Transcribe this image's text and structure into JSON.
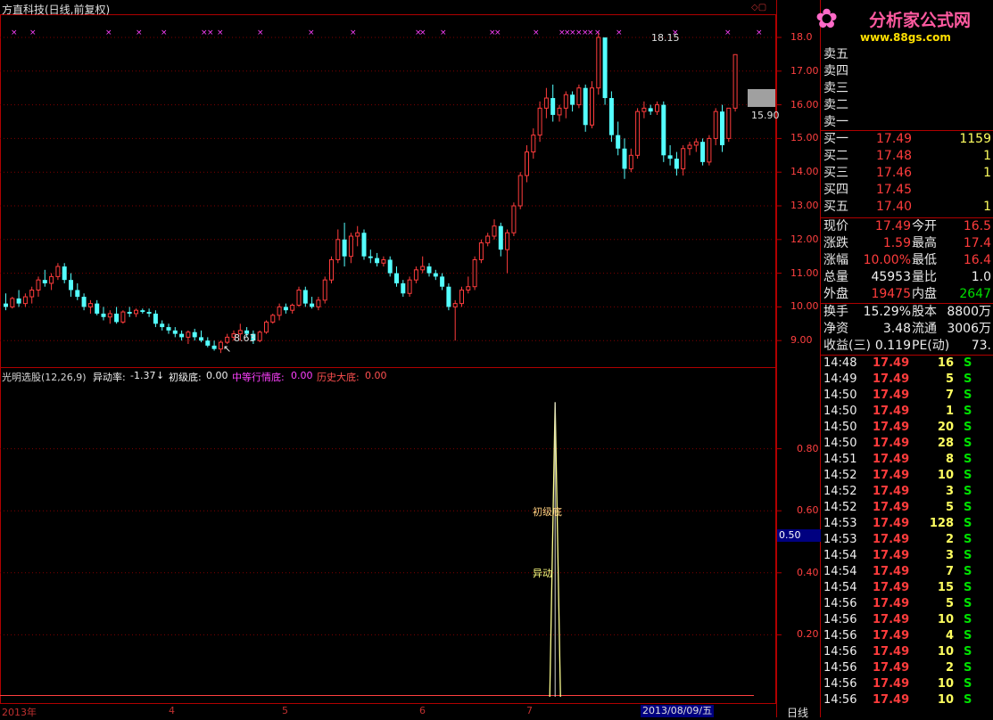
{
  "window": {
    "title": "方直科技(日线,前复权)"
  },
  "logo": {
    "name": "分析家公式网",
    "url": "www.88gs.com"
  },
  "indicator": {
    "name": "光明选股(12,26,9)",
    "yidong_label": "异动率:",
    "yidong_value": "-1.37",
    "chuji_label": "初级底:",
    "chuji_value": "0.00",
    "zhong_label": "中等行情底:",
    "zhong_value": "0.00",
    "lishi_label": "历史大底:",
    "lishi_value": "0.00",
    "signal_label_1": "初级底",
    "signal_label_2": "异动"
  },
  "price_axis": [
    "18.0",
    "17.00",
    "16.00",
    "15.00",
    "14.00",
    "13.00",
    "12.00",
    "11.00",
    "10.00",
    "9.00"
  ],
  "ind_axis": [
    "0.80",
    "0.60",
    "0.40",
    "0.20"
  ],
  "ind_cursor_value": "0.50",
  "x_axis": {
    "labels": [
      "2013年",
      "4",
      "5",
      "6",
      "7"
    ],
    "cursor_date": "2013/08/09/五",
    "period": "日线"
  },
  "annotations": {
    "high": "18.15",
    "low": "8.63",
    "last": "15.90"
  },
  "order_book": {
    "sell": [
      {
        "label": "卖五",
        "price": "",
        "vol": ""
      },
      {
        "label": "卖四",
        "price": "",
        "vol": ""
      },
      {
        "label": "卖三",
        "price": "",
        "vol": ""
      },
      {
        "label": "卖二",
        "price": "",
        "vol": ""
      },
      {
        "label": "卖一",
        "price": "",
        "vol": ""
      }
    ],
    "buy": [
      {
        "label": "买一",
        "price": "17.49",
        "vol": "1159"
      },
      {
        "label": "买二",
        "price": "17.48",
        "vol": "1"
      },
      {
        "label": "买三",
        "price": "17.46",
        "vol": "1"
      },
      {
        "label": "买四",
        "price": "17.45",
        "vol": ""
      },
      {
        "label": "买五",
        "price": "17.40",
        "vol": "1"
      }
    ]
  },
  "quote": [
    {
      "l1": "现价",
      "v1": "17.49",
      "c1": "red",
      "l2": "今开",
      "v2": "16.5",
      "c2": "red"
    },
    {
      "l1": "涨跌",
      "v1": "1.59",
      "c1": "red",
      "l2": "最高",
      "v2": "17.4",
      "c2": "red"
    },
    {
      "l1": "涨幅",
      "v1": "10.00%",
      "c1": "red",
      "l2": "最低",
      "v2": "16.4",
      "c2": "red"
    },
    {
      "l1": "总量",
      "v1": "45953",
      "c1": "wht",
      "l2": "量比",
      "v2": "1.0",
      "c2": "wht"
    },
    {
      "l1": "外盘",
      "v1": "19475",
      "c1": "red",
      "l2": "内盘",
      "v2": "2647",
      "c2": "grn"
    }
  ],
  "fundamentals": [
    {
      "l1": "换手",
      "v1": "15.29%",
      "l2": "股本",
      "v2": "8800万"
    },
    {
      "l1": "净资",
      "v1": "3.48",
      "l2": "流通",
      "v2": "3006万"
    },
    {
      "l1": "收益(三)",
      "v1": "0.119",
      "l2": "PE(动)",
      "v2": "73."
    }
  ],
  "ticks": [
    {
      "t": "14:48",
      "p": "17.49",
      "v": "16",
      "s": "S"
    },
    {
      "t": "14:49",
      "p": "17.49",
      "v": "5",
      "s": "S"
    },
    {
      "t": "14:50",
      "p": "17.49",
      "v": "7",
      "s": "S"
    },
    {
      "t": "14:50",
      "p": "17.49",
      "v": "1",
      "s": "S"
    },
    {
      "t": "14:50",
      "p": "17.49",
      "v": "20",
      "s": "S"
    },
    {
      "t": "14:50",
      "p": "17.49",
      "v": "28",
      "s": "S"
    },
    {
      "t": "14:51",
      "p": "17.49",
      "v": "8",
      "s": "S"
    },
    {
      "t": "14:52",
      "p": "17.49",
      "v": "10",
      "s": "S"
    },
    {
      "t": "14:52",
      "p": "17.49",
      "v": "3",
      "s": "S"
    },
    {
      "t": "14:52",
      "p": "17.49",
      "v": "5",
      "s": "S"
    },
    {
      "t": "14:53",
      "p": "17.49",
      "v": "128",
      "s": "S"
    },
    {
      "t": "14:53",
      "p": "17.49",
      "v": "2",
      "s": "S"
    },
    {
      "t": "14:54",
      "p": "17.49",
      "v": "3",
      "s": "S"
    },
    {
      "t": "14:54",
      "p": "17.49",
      "v": "7",
      "s": "S"
    },
    {
      "t": "14:54",
      "p": "17.49",
      "v": "15",
      "s": "S"
    },
    {
      "t": "14:56",
      "p": "17.49",
      "v": "5",
      "s": "S"
    },
    {
      "t": "14:56",
      "p": "17.49",
      "v": "10",
      "s": "S"
    },
    {
      "t": "14:56",
      "p": "17.49",
      "v": "4",
      "s": "S"
    },
    {
      "t": "14:56",
      "p": "17.49",
      "v": "10",
      "s": "S"
    },
    {
      "t": "14:56",
      "p": "17.49",
      "v": "2",
      "s": "S"
    },
    {
      "t": "14:56",
      "p": "17.49",
      "v": "10",
      "s": "S"
    },
    {
      "t": "14:56",
      "p": "17.49",
      "v": "10",
      "s": "S"
    }
  ],
  "colors": {
    "up": "#ff3c3c",
    "down": "#54ffff",
    "grid": "#800000",
    "axis": "#b00000",
    "marker": "#ff40ff",
    "signal": "#ffff90"
  },
  "chart_data": [
    {
      "type": "candlestick",
      "title": "方直科技(日线,前复权)",
      "ylim": [
        8.6,
        18.3
      ],
      "candles": [
        [
          10.1,
          10.4,
          9.9,
          10.0
        ],
        [
          10.0,
          10.3,
          9.95,
          10.25
        ],
        [
          10.25,
          10.5,
          10.0,
          10.1
        ],
        [
          10.1,
          10.4,
          10.0,
          10.3
        ],
        [
          10.3,
          10.6,
          10.1,
          10.5
        ],
        [
          10.5,
          10.9,
          10.3,
          10.8
        ],
        [
          10.8,
          11.1,
          10.6,
          10.7
        ],
        [
          10.7,
          11.0,
          10.5,
          10.9
        ],
        [
          10.9,
          11.3,
          10.8,
          11.2
        ],
        [
          11.2,
          11.3,
          10.7,
          10.8
        ],
        [
          10.8,
          11.0,
          10.3,
          10.5
        ],
        [
          10.5,
          10.7,
          10.2,
          10.3
        ],
        [
          10.3,
          10.4,
          9.9,
          10.0
        ],
        [
          10.0,
          10.2,
          9.8,
          10.1
        ],
        [
          10.1,
          10.2,
          9.75,
          9.8
        ],
        [
          9.8,
          10.0,
          9.6,
          9.7
        ],
        [
          9.7,
          9.9,
          9.5,
          9.8
        ],
        [
          9.8,
          10.0,
          9.5,
          9.55
        ],
        [
          9.55,
          9.9,
          9.5,
          9.85
        ],
        [
          9.85,
          10.0,
          9.7,
          9.8
        ],
        [
          9.8,
          9.95,
          9.7,
          9.9
        ],
        [
          9.9,
          9.95,
          9.8,
          9.85
        ],
        [
          9.85,
          9.95,
          9.7,
          9.8
        ],
        [
          9.8,
          9.9,
          9.4,
          9.5
        ],
        [
          9.5,
          9.6,
          9.3,
          9.4
        ],
        [
          9.4,
          9.5,
          9.2,
          9.3
        ],
        [
          9.3,
          9.4,
          9.1,
          9.2
        ],
        [
          9.2,
          9.3,
          9.0,
          9.1
        ],
        [
          9.1,
          9.3,
          8.9,
          9.25
        ],
        [
          9.25,
          9.35,
          9.0,
          9.1
        ],
        [
          9.1,
          9.3,
          8.95,
          9.0
        ],
        [
          9.0,
          9.1,
          8.8,
          8.85
        ],
        [
          8.85,
          9.0,
          8.7,
          8.75
        ],
        [
          8.75,
          9.0,
          8.63,
          8.95
        ],
        [
          8.95,
          9.2,
          8.9,
          9.1
        ],
        [
          9.1,
          9.3,
          9.0,
          9.2
        ],
        [
          9.2,
          9.5,
          9.0,
          9.3
        ],
        [
          9.3,
          9.4,
          9.1,
          9.2
        ],
        [
          9.2,
          9.3,
          8.9,
          9.0
        ],
        [
          9.0,
          9.3,
          8.95,
          9.25
        ],
        [
          9.25,
          9.6,
          9.2,
          9.55
        ],
        [
          9.55,
          9.8,
          9.5,
          9.75
        ],
        [
          9.75,
          10.1,
          9.6,
          10.0
        ],
        [
          10.0,
          10.1,
          9.8,
          9.9
        ],
        [
          9.9,
          10.1,
          9.8,
          10.05
        ],
        [
          10.05,
          10.6,
          10.0,
          10.5
        ],
        [
          10.5,
          10.6,
          10.0,
          10.1
        ],
        [
          10.1,
          10.3,
          9.95,
          10.0
        ],
        [
          10.0,
          10.3,
          9.9,
          10.2
        ],
        [
          10.2,
          10.9,
          10.1,
          10.8
        ],
        [
          10.8,
          11.5,
          10.7,
          11.4
        ],
        [
          11.4,
          12.3,
          11.3,
          12.0
        ],
        [
          12.0,
          12.5,
          11.2,
          11.5
        ],
        [
          11.5,
          12.2,
          11.3,
          12.1
        ],
        [
          12.1,
          12.4,
          11.8,
          12.2
        ],
        [
          12.2,
          12.3,
          11.4,
          11.5
        ],
        [
          11.5,
          11.7,
          11.3,
          11.45
        ],
        [
          11.45,
          11.6,
          11.2,
          11.3
        ],
        [
          11.3,
          11.5,
          11.2,
          11.4
        ],
        [
          11.4,
          11.5,
          10.9,
          11.0
        ],
        [
          11.0,
          11.2,
          10.6,
          10.7
        ],
        [
          10.7,
          10.8,
          10.3,
          10.4
        ],
        [
          10.4,
          10.9,
          10.3,
          10.8
        ],
        [
          10.8,
          11.2,
          10.7,
          11.1
        ],
        [
          11.1,
          11.5,
          11.0,
          11.2
        ],
        [
          11.2,
          11.3,
          10.9,
          11.0
        ],
        [
          11.0,
          11.1,
          10.8,
          10.9
        ],
        [
          10.9,
          11.0,
          10.5,
          10.6
        ],
        [
          10.6,
          10.7,
          9.9,
          10.0
        ],
        [
          10.0,
          10.2,
          9.0,
          10.1
        ],
        [
          10.1,
          10.6,
          10.0,
          10.5
        ],
        [
          10.5,
          10.9,
          10.4,
          10.6
        ],
        [
          10.6,
          11.5,
          10.5,
          11.4
        ],
        [
          11.4,
          12.0,
          11.3,
          11.9
        ],
        [
          11.9,
          12.2,
          11.8,
          12.1
        ],
        [
          12.1,
          12.6,
          12.0,
          12.4
        ],
        [
          12.4,
          12.5,
          11.5,
          11.7
        ],
        [
          11.7,
          12.3,
          11.0,
          12.2
        ],
        [
          12.2,
          13.1,
          12.1,
          13.0
        ],
        [
          13.0,
          14.0,
          12.9,
          13.9
        ],
        [
          13.9,
          14.8,
          13.7,
          14.6
        ],
        [
          14.6,
          15.3,
          14.4,
          15.1
        ],
        [
          15.1,
          16.1,
          14.9,
          15.9
        ],
        [
          15.9,
          16.5,
          15.6,
          16.2
        ],
        [
          16.2,
          16.6,
          15.5,
          15.7
        ],
        [
          15.7,
          16.0,
          15.5,
          15.9
        ],
        [
          15.9,
          16.4,
          15.6,
          16.3
        ],
        [
          16.3,
          16.4,
          15.8,
          16.0
        ],
        [
          16.0,
          16.6,
          15.9,
          16.5
        ],
        [
          16.5,
          16.6,
          15.2,
          15.4
        ],
        [
          15.4,
          16.7,
          15.3,
          16.5
        ],
        [
          16.5,
          18.15,
          16.3,
          18.0
        ],
        [
          18.0,
          18.0,
          16.0,
          16.2
        ],
        [
          16.2,
          16.4,
          14.9,
          15.1
        ],
        [
          15.1,
          15.5,
          14.5,
          14.7
        ],
        [
          14.7,
          15.0,
          13.8,
          14.1
        ],
        [
          14.1,
          14.7,
          14.0,
          14.5
        ],
        [
          14.5,
          15.9,
          14.4,
          15.8
        ],
        [
          15.8,
          16.1,
          15.6,
          15.9
        ],
        [
          15.9,
          16.0,
          15.7,
          15.8
        ],
        [
          15.8,
          16.1,
          15.7,
          16.0
        ],
        [
          16.0,
          16.1,
          14.3,
          14.5
        ],
        [
          14.5,
          14.8,
          14.2,
          14.4
        ],
        [
          14.4,
          14.6,
          13.9,
          14.1
        ],
        [
          14.1,
          14.8,
          13.9,
          14.7
        ],
        [
          14.7,
          14.9,
          14.5,
          14.8
        ],
        [
          14.8,
          15.0,
          14.6,
          14.9
        ],
        [
          14.9,
          15.0,
          14.2,
          14.3
        ],
        [
          14.3,
          15.1,
          14.2,
          15.0
        ],
        [
          15.0,
          15.9,
          14.8,
          15.8
        ],
        [
          15.8,
          16.0,
          14.6,
          14.8
        ],
        [
          15.0,
          15.9,
          14.9,
          15.9
        ],
        [
          15.9,
          17.5,
          15.8,
          17.49
        ]
      ]
    },
    {
      "type": "line",
      "title": "光明选股(12,26,9)",
      "ylim": [
        0,
        1.0
      ],
      "series": [
        {
          "spike_index": 84,
          "values_peak": 0.95
        }
      ]
    }
  ]
}
